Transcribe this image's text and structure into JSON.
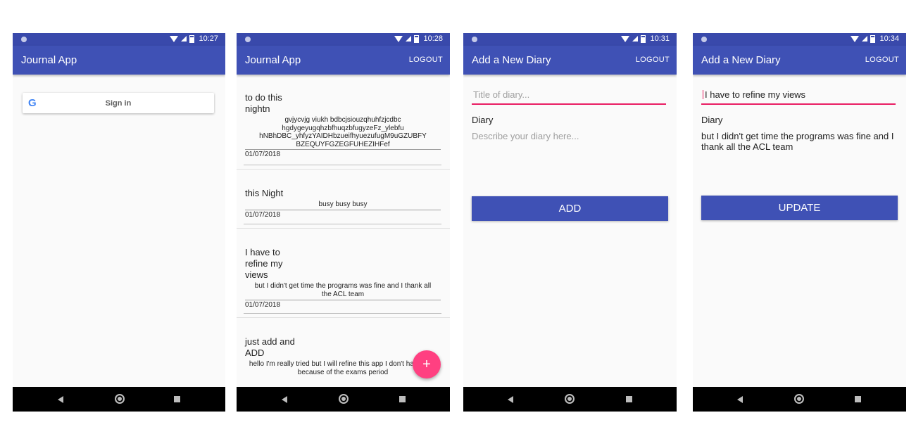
{
  "screens": [
    {
      "time": "10:27",
      "app_title": "Journal App",
      "signin_label": "Sign in",
      "google_glyph": "G"
    },
    {
      "time": "10:28",
      "app_title": "Journal App",
      "logout": "LOGOUT",
      "entries": [
        {
          "title": "to do this nightn",
          "desc": "gvjycvjg viukh bdbcjsiouzqhuhfzjcdbc hgdygeyugqhzbfhuqzbfugyzeFz_ylebfu hNBhDBC_yhfyzYAIDHbzueifhyuezufugM9uGZUBFY BZEQUYFGZEGFUHEZIHFef",
          "date": "01/07/2018"
        },
        {
          "title": "this Night",
          "desc": "busy busy busy",
          "date": "01/07/2018"
        },
        {
          "title": "I have to refine my views",
          "desc": "but I didn't get time the programs was fine and I thank all the ACL team",
          "date": "01/07/2018"
        },
        {
          "title": "just add and ADD",
          "desc": "hello I'm really tried but I will refine this app  I don't have time because of the exams period",
          "date": ""
        }
      ],
      "fab_label": "+"
    },
    {
      "time": "10:31",
      "app_title": "Add a New Diary",
      "logout": "LOGOUT",
      "title_placeholder": "Title of diary...",
      "diary_label": "Diary",
      "desc_placeholder": "Describe your diary here...",
      "button": "ADD"
    },
    {
      "time": "10:34",
      "app_title": "Add a New Diary",
      "logout": "LOGOUT",
      "title_value": "I have to refine my views",
      "diary_label": "Diary",
      "desc_value": "but I didn't get time the programs was fine and I thank all the ACL team",
      "button": "UPDATE"
    }
  ],
  "colors": {
    "primary": "#3f51b5",
    "primary_dark": "#3949ab",
    "accent": "#ff4081"
  }
}
